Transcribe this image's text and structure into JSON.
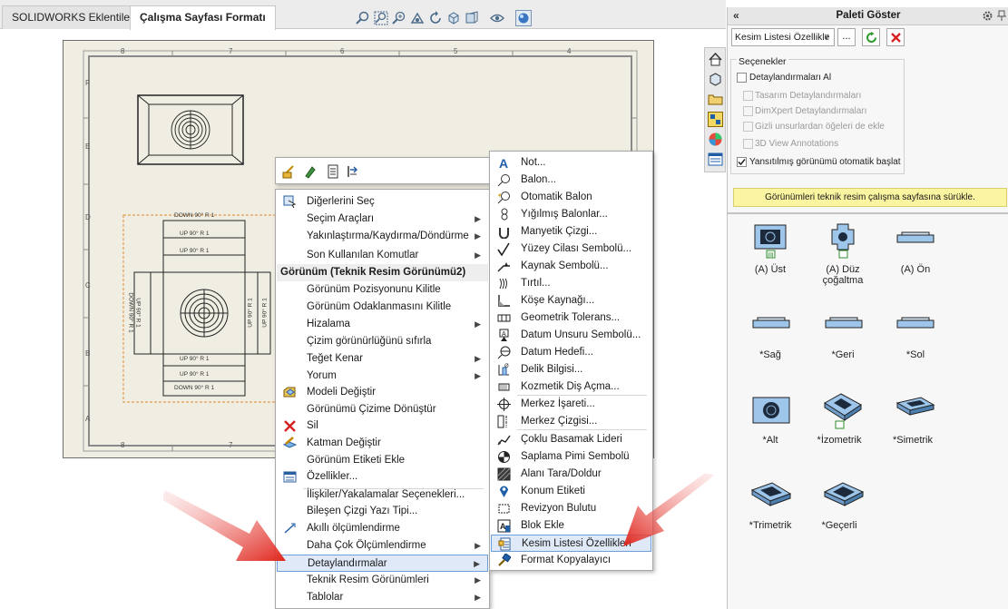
{
  "tabs": [
    {
      "label": "SOLIDWORKS Eklentileri"
    },
    {
      "label": "Çalışma Sayfası Formatı"
    }
  ],
  "icons": {
    "toolbar": [
      "zoom-fit-icon",
      "zoom-area-icon",
      "zoom-in-icon",
      "pan-icon",
      "rotate-icon",
      "view-orientation-icon",
      "hide-show-icon",
      "apply-scene-icon"
    ],
    "side_tabs": [
      "home-icon",
      "parts-library-icon",
      "file-explorer-icon",
      "view-palette-icon",
      "appearances-icon",
      "custom-properties-icon"
    ]
  },
  "drawing": {
    "border_columns": [
      "8",
      "7",
      "6",
      "5",
      "4"
    ],
    "border_rows": [
      "F",
      "E",
      "D",
      "C",
      "B",
      "A"
    ],
    "notes": {
      "down_90_r1": "DOWN 90° R 1",
      "up_90_r1": "UP 90° R 1"
    }
  },
  "context_menu": {
    "toolbar_icons": [
      "smart-dimension-icon",
      "layer-icon",
      "annotation-icon",
      "properties-icon"
    ],
    "items": [
      {
        "label": "Diğerlerini Seç",
        "icon": "select-others-icon"
      },
      {
        "label": "Seçim Araçları",
        "submenu": true
      },
      {
        "label": "Yakınlaştırma/Kaydırma/Döndürme",
        "submenu": true
      },
      {
        "label": "Son Kullanılan Komutlar",
        "submenu": true
      },
      {
        "label": "Görünüm (Teknik Resim Görünümü2)",
        "header": true
      },
      {
        "label": "Görünüm Pozisyonunu Kilitle"
      },
      {
        "label": "Görünüm Odaklanmasını Kilitle"
      },
      {
        "label": "Hizalama",
        "submenu": true
      },
      {
        "label": "Çizim görünürlüğünü sıfırla"
      },
      {
        "label": "Teğet Kenar",
        "submenu": true
      },
      {
        "label": "Yorum",
        "submenu": true
      },
      {
        "label": "Modeli Değiştir",
        "icon": "open-model-icon"
      },
      {
        "label": "Görünümü Çizime Dönüştür"
      },
      {
        "label": "Sil",
        "icon": "delete-icon"
      },
      {
        "label": "Katman Değiştir",
        "icon": "change-layer-icon"
      },
      {
        "label": "Görünüm Etiketi Ekle"
      },
      {
        "label": "Özellikler...",
        "icon": "properties-icon"
      },
      {
        "label": "İlişkiler/Yakalamalar Seçenekleri..."
      },
      {
        "label": "Bileşen Çizgi Yazı Tipi..."
      },
      {
        "label": "Akıllı ölçümlendirme",
        "icon": "smart-dimension-icon"
      },
      {
        "label": "Daha Çok Ölçümlendirme",
        "submenu": true
      },
      {
        "label": "Detaylandırmalar",
        "submenu": true,
        "highlight": true
      },
      {
        "label": "Teknik Resim Görünümleri",
        "submenu": true
      },
      {
        "label": "Tablolar",
        "submenu": true
      }
    ]
  },
  "submenu": {
    "items": [
      {
        "label": "Not...",
        "icon": "note-icon"
      },
      {
        "label": "Balon...",
        "icon": "balloon-icon"
      },
      {
        "label": "Otomatik Balon",
        "icon": "auto-balloon-icon"
      },
      {
        "label": "Yığılmış Balonlar...",
        "icon": "stacked-balloon-icon"
      },
      {
        "label": "Manyetik Çizgi...",
        "icon": "magnetic-line-icon"
      },
      {
        "label": "Yüzey Cilası Sembolü...",
        "icon": "surface-finish-icon"
      },
      {
        "label": "Kaynak Sembolü...",
        "icon": "weld-symbol-icon"
      },
      {
        "label": "Tırtıl...",
        "icon": "weld-bead-icon"
      },
      {
        "label": "Köşe Kaynağı...",
        "icon": "fillet-weld-icon"
      },
      {
        "label": "Geometrik Tolerans...",
        "icon": "geometric-tolerance-icon"
      },
      {
        "label": "Datum Unsuru Sembolü...",
        "icon": "datum-feature-icon"
      },
      {
        "label": "Datum Hedefi...",
        "icon": "datum-target-icon"
      },
      {
        "label": "Delik Bilgisi...",
        "icon": "hole-callout-icon"
      },
      {
        "label": "Kozmetik Diş Açma...",
        "icon": "cosmetic-thread-icon"
      },
      {
        "label": "Merkez İşareti...",
        "icon": "center-mark-icon"
      },
      {
        "label": "Merkez Çizgisi...",
        "icon": "centerline-icon"
      },
      {
        "label": "Çoklu Basamak Lideri",
        "icon": "multi-jog-leader-icon"
      },
      {
        "label": "Saplama Pimi Sembolü",
        "icon": "dowel-pin-icon"
      },
      {
        "label": "Alanı Tara/Doldur",
        "icon": "area-hatch-icon"
      },
      {
        "label": "Konum Etiketi",
        "icon": "location-label-icon"
      },
      {
        "label": "Revizyon Bulutu",
        "icon": "revision-cloud-icon"
      },
      {
        "label": "Blok Ekle",
        "icon": "insert-block-icon"
      },
      {
        "label": "Kesim Listesi Özellikleri",
        "icon": "cut-list-properties-icon",
        "highlight": true
      },
      {
        "label": "Format Kopyalayıcı",
        "icon": "format-painter-icon"
      }
    ]
  },
  "panel": {
    "title": "Paleti Göster",
    "collapse_label": "«",
    "dropdown_value": "Kesim Listesi Özellikle",
    "browse_label": "...",
    "options_title": "Seçenekler",
    "options": [
      {
        "label": "Detaylandırmaları Al",
        "checked": false,
        "enabled": true
      },
      {
        "label": "Tasarım Detaylandırmaları",
        "checked": false,
        "enabled": false
      },
      {
        "label": "DimXpert Detaylandırmaları",
        "checked": false,
        "enabled": false
      },
      {
        "label": "Gizli unsurlardan öğeleri de ekle",
        "checked": false,
        "enabled": false
      },
      {
        "label": "3D View Annotations",
        "checked": false,
        "enabled": false
      },
      {
        "label": "Yansıtılmış görünümü otomatik başlat",
        "checked": true,
        "enabled": true
      }
    ],
    "hint": "Görünümleri teknik resim çalışma sayfasına sürükle.",
    "views": [
      {
        "label": "(A) Üst"
      },
      {
        "label": "(A) Düz çoğaltma"
      },
      {
        "label": "(A) Ön"
      },
      {
        "label": "*Sağ"
      },
      {
        "label": "*Geri"
      },
      {
        "label": "*Sol"
      },
      {
        "label": "*Alt"
      },
      {
        "label": "*İzometrik"
      },
      {
        "label": "*Simetrik"
      },
      {
        "label": "*Trimetrik"
      },
      {
        "label": "*Geçerli"
      }
    ]
  },
  "colors": {
    "sheet_bg": "#f0ede2",
    "highlight_bg": "#dfe9f7",
    "highlight_border": "#6f9fd8",
    "hint_bg": "#fbf4a0",
    "arrow_red": "#e0251b",
    "icon_blue": "#1f5fa8"
  }
}
